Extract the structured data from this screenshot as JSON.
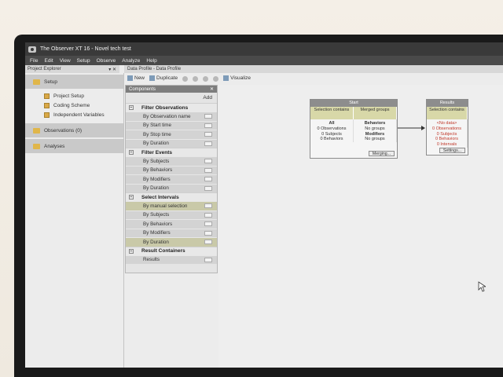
{
  "window": {
    "title": "The Observer XT 16 - Novel tech test"
  },
  "menu": [
    "File",
    "Edit",
    "View",
    "Setup",
    "Observe",
    "Analyze",
    "Help"
  ],
  "explorer": {
    "header": "Project Explorer",
    "header_controls": "▾ ✕",
    "setup_label": "Setup",
    "setup_items": [
      "Project Setup",
      "Coding Scheme",
      "Independent Variables"
    ],
    "observations_label": "Observations (0)",
    "analyses_label": "Analyses"
  },
  "tab": {
    "label": "Data Profile - Data Profile"
  },
  "toolbar": {
    "new_label": "New",
    "duplicate_label": "Duplicate",
    "visualize_label": "Visualize"
  },
  "components": {
    "title": "Components",
    "close": "✕",
    "add_label": "Add",
    "groups": [
      {
        "label": "Filter Observations",
        "rows": [
          {
            "label": "By Observation name",
            "olive": false
          },
          {
            "label": "By Start time",
            "olive": false
          },
          {
            "label": "By Stop time",
            "olive": false
          },
          {
            "label": "By Duration",
            "olive": false
          }
        ]
      },
      {
        "label": "Filter Events",
        "rows": [
          {
            "label": "By Subjects",
            "olive": false
          },
          {
            "label": "By Behaviors",
            "olive": false
          },
          {
            "label": "By Modifiers",
            "olive": false
          },
          {
            "label": "By Duration",
            "olive": false
          }
        ]
      },
      {
        "label": "Select Intervals",
        "rows": [
          {
            "label": "By manual selection",
            "olive": true
          },
          {
            "label": "By Subjects",
            "olive": false
          },
          {
            "label": "By Behaviors",
            "olive": false
          },
          {
            "label": "By Modifiers",
            "olive": false
          },
          {
            "label": "By Duration",
            "olive": true
          }
        ]
      },
      {
        "label": "Result Containers",
        "rows": [
          {
            "label": "Results",
            "olive": false
          }
        ]
      }
    ]
  },
  "start_box": {
    "title": "Start",
    "left_header": "Selection contains",
    "right_header": "Merged groups",
    "left_lines": [
      "All",
      "0 Observations",
      "0 Subjects",
      "0 Behaviors"
    ],
    "right_lines": [
      "Behaviors",
      "No groups",
      "Modifiers",
      "No groups"
    ],
    "button": "Merging..."
  },
  "results_box": {
    "title": "Results",
    "header": "Selection contains",
    "lines": [
      "<No data>",
      "0 Observations",
      "0 Subjects",
      "0 Behaviors",
      "0 Intervals"
    ],
    "button": "Settings..."
  },
  "colors": {
    "titlebar": "#3a3a3a",
    "olive_row": "#c9c9a8",
    "box_header": "#d8d8a8",
    "results_text": "#c0392b"
  }
}
